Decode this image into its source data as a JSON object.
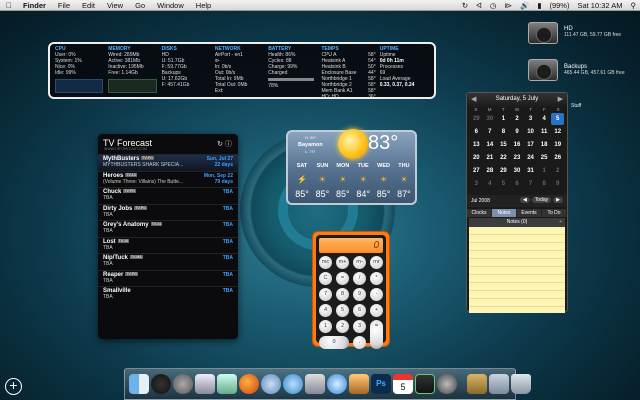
{
  "menubar": {
    "app": "Finder",
    "items": [
      "File",
      "Edit",
      "View",
      "Go",
      "Window",
      "Help"
    ],
    "battery": "(99%)",
    "clock": "Sat 10:32 AM"
  },
  "stats": {
    "cpu": {
      "title": "CPU",
      "lines": [
        "User: 0%",
        "System: 1%",
        "Nice: 0%",
        "Idle: 99%"
      ]
    },
    "memory": {
      "title": "MEMORY",
      "lines": [
        "Wired: 289Mb",
        "Active: 381Mb",
        "Inactive: 195Mb",
        "Free: 1.14Gb"
      ]
    },
    "disks": {
      "title": "DISKS",
      "lines": [
        "HD",
        "U: 51.7Gb",
        "F: 59.77Gb",
        "Backups",
        "U: 17.62Gb",
        "F: 457.41Gb"
      ]
    },
    "network": {
      "title": "NETWORK",
      "lines": [
        "AirPort - en1",
        "In: 0b/s",
        "Out: 0b/s",
        "Total In: 9Mb",
        "Total Out: 0Mb",
        "Ext:"
      ]
    },
    "battery": {
      "title": "BATTERY",
      "lines": [
        "Health: 86%",
        "Cycles: 88",
        "Charge: 99%",
        "Charged",
        "78%"
      ]
    },
    "temps": {
      "title": "TEMPS",
      "lines": [
        "CPU A",
        "Heatsink A",
        "Heatsink B",
        "Enclosure Base",
        "Northbridge 1",
        "Northbridge 2",
        "Mem Bank A1",
        "HD: HD"
      ],
      "values": [
        "58°",
        "54°",
        "50°",
        "44°",
        "58°",
        "58°",
        "58°",
        "36°"
      ]
    },
    "uptime": {
      "title": "UPTIME",
      "lines": [
        "Uptime",
        "0d 0h 11m",
        "Processes",
        "69",
        "Load Average",
        "0.33, 0.37, 0.24"
      ]
    }
  },
  "drives": [
    {
      "name": "HD",
      "info": "111.47 GB, 59.77 GB free"
    },
    {
      "name": "Backups",
      "info": "465.44 GB, 457.61 GB free"
    }
  ],
  "tv": {
    "title": "TV Forecast",
    "subtitle": "WWW.TVFORECAST.COM",
    "shows": [
      {
        "name": "MythBusters",
        "badge": "TV-PG",
        "episode": "MYTHBUSTERS SHARK SPECIA...",
        "date": "Sun, Jul 27",
        "days": "22 days"
      },
      {
        "name": "Heroes",
        "badge": "TV-14",
        "episode": "(Volume Three: Villains) The Butte...",
        "date": "Mon, Sep 22",
        "days": "79 days"
      },
      {
        "name": "Chuck",
        "badge": "TV-PG",
        "episode": "TBA",
        "date": "TBA",
        "days": ""
      },
      {
        "name": "Dirty Jobs",
        "badge": "TV-PG",
        "episode": "TBA",
        "date": "TBA",
        "days": ""
      },
      {
        "name": "Grey's Anatomy",
        "badge": "TV-14",
        "episode": "TBA",
        "date": "TBA",
        "days": ""
      },
      {
        "name": "Lost",
        "badge": "TV-14",
        "episode": "TBA",
        "date": "TBA",
        "days": ""
      },
      {
        "name": "Nip/Tuck",
        "badge": "TV-MA",
        "episode": "TBA",
        "date": "TBA",
        "days": ""
      },
      {
        "name": "Reaper",
        "badge": "TV-PG",
        "episode": "TBA",
        "date": "TBA",
        "days": ""
      },
      {
        "name": "Smallville",
        "badge": "",
        "episode": "TBA",
        "date": "TBA",
        "days": ""
      }
    ]
  },
  "weather": {
    "location": "Bayamon",
    "high": "H: 86°",
    "low": "L: 79°",
    "current": "83°",
    "days": [
      "SAT",
      "SUN",
      "MON",
      "TUE",
      "WED",
      "THU"
    ],
    "temps": [
      "85°",
      "85°",
      "85°",
      "84°",
      "85°",
      "87°"
    ]
  },
  "calendar": {
    "header": "Saturday, 5 July",
    "dow": [
      "S",
      "M",
      "T",
      "W",
      "T",
      "F",
      "S"
    ],
    "days": [
      "29",
      "30",
      "1",
      "2",
      "3",
      "4",
      "5",
      "6",
      "7",
      "8",
      "9",
      "10",
      "11",
      "12",
      "13",
      "14",
      "15",
      "16",
      "17",
      "18",
      "19",
      "20",
      "21",
      "22",
      "23",
      "24",
      "25",
      "26",
      "27",
      "28",
      "29",
      "30",
      "31",
      "1",
      "2",
      "3",
      "4",
      "5",
      "6",
      "7",
      "8",
      "9"
    ],
    "today_index": 6,
    "month": "Jul 2008",
    "today_btn": "Today",
    "tabs": [
      "Clocks",
      "Notes",
      "Events",
      "To Do"
    ],
    "notes_header": "Notes (0)",
    "side_label": "Stuff"
  },
  "calculator": {
    "display": "0",
    "keys": [
      "mc",
      "m+",
      "m-",
      "mr",
      "C",
      "=",
      "/",
      "*",
      "7",
      "8",
      "9",
      "-",
      "4",
      "5",
      "6",
      "+",
      "1",
      "2",
      "3",
      "=",
      "0",
      "."
    ]
  }
}
